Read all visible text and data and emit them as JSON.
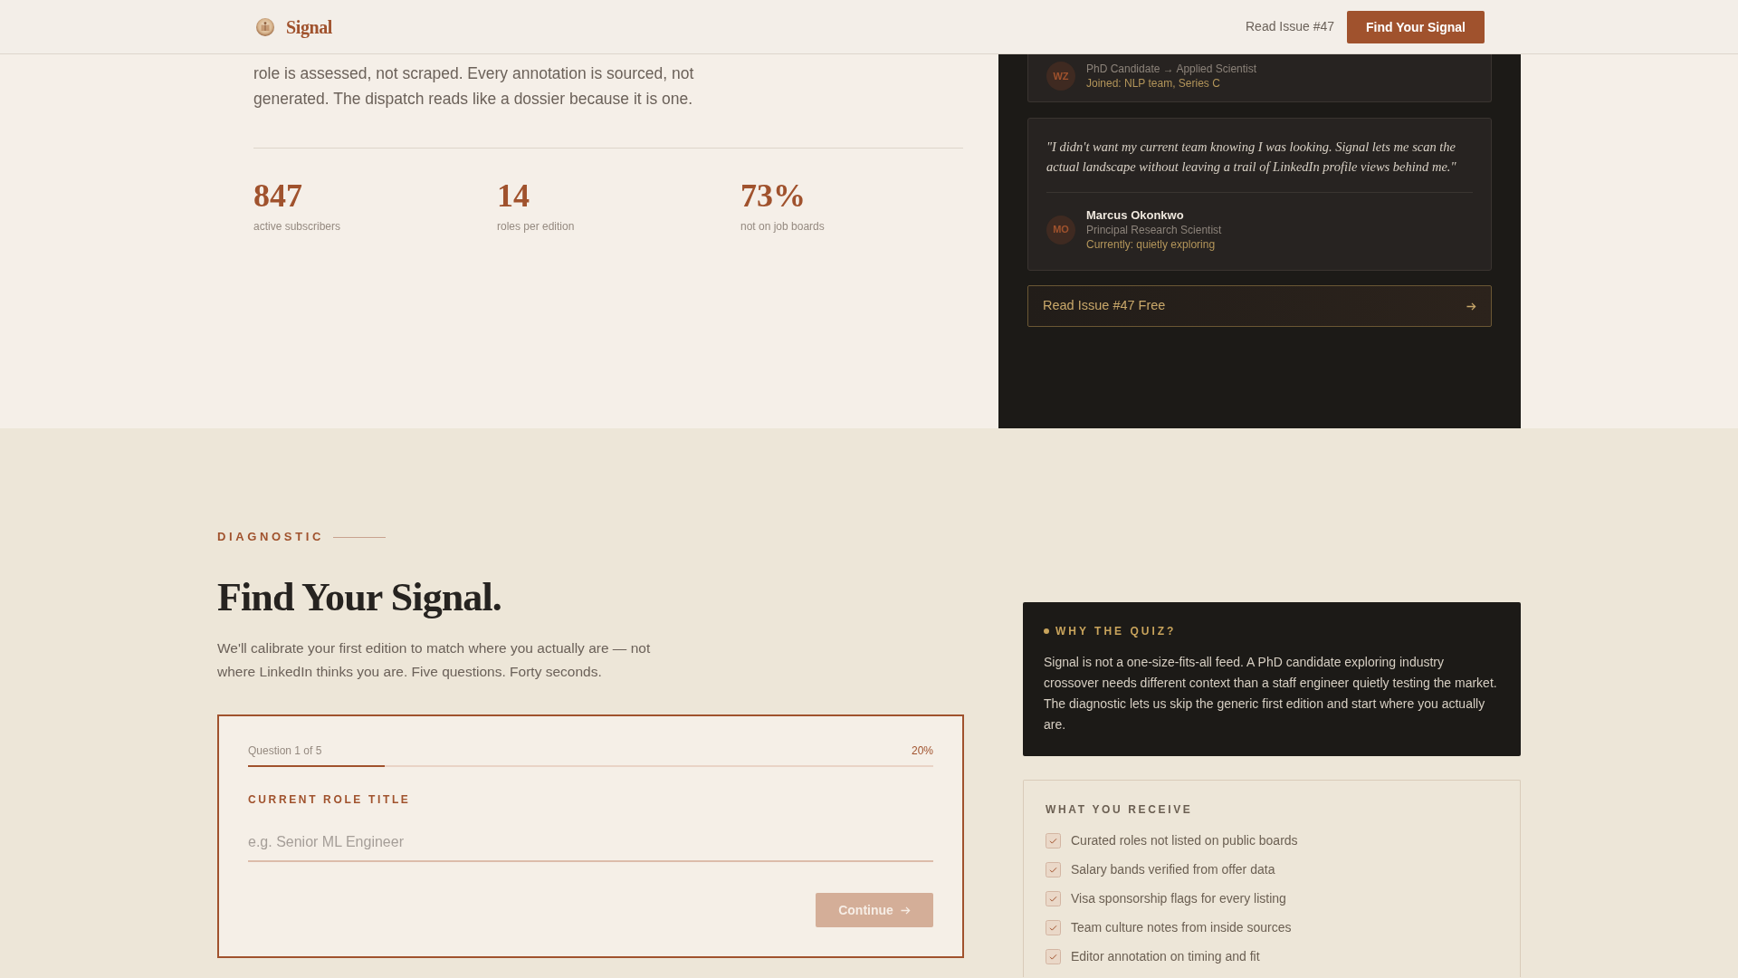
{
  "header": {
    "brand": "Signal",
    "link": "Read Issue #47",
    "button": "Find Your Signal"
  },
  "intro": {
    "text": "role is assessed, not scraped. Every annotation is sourced, not generated. The dispatch reads like a dossier because it is one."
  },
  "stats": [
    {
      "value": "847",
      "label": "active subscribers"
    },
    {
      "value": "14",
      "label": "roles per edition"
    },
    {
      "value": "73%",
      "label": "not on job boards"
    }
  ],
  "testimonials": [
    {
      "initials": "WZ",
      "role": "PhD Candidate → Applied Scientist",
      "outcome": "Joined: NLP team, Series C"
    },
    {
      "quote": "\"I didn't want my current team knowing I was looking. Signal lets me scan the actual landscape without leaving a trail of LinkedIn profile views behind me.\"",
      "initials": "MO",
      "name": "Marcus Okonkwo",
      "role": "Principal Research Scientist",
      "outcome": "Currently: quietly exploring"
    }
  ],
  "panel_link": "Read Issue #47 Free",
  "diagnostic": {
    "eyebrow": "DIAGNOSTIC",
    "title": "Find Your Signal.",
    "text": "We'll calibrate your first edition to match where you actually are — not where LinkedIn thinks you are. Five questions. Forty seconds."
  },
  "quiz": {
    "step": "Question 1 of 5",
    "percent": "20%",
    "level": 0.2,
    "field_label": "CURRENT ROLE TITLE",
    "placeholder": "e.g. Senior ML Engineer",
    "button": {
      "label": "Continue",
      "disabled": true
    }
  },
  "why": {
    "title": "WHY THE QUIZ?",
    "text": "Signal is not a one-size-fits-all feed. A PhD candidate exploring industry crossover needs different context than a staff engineer quietly testing the market. The diagnostic lets us skip the generic first edition and start where you actually are."
  },
  "receive": {
    "title": "WHAT YOU RECEIVE",
    "items": [
      {
        "label": "Curated roles not listed on public boards",
        "checked": true
      },
      {
        "label": "Salary bands verified from offer data",
        "checked": true
      },
      {
        "label": "Visa sponsorship flags for every listing",
        "checked": true
      },
      {
        "label": "Team culture notes from inside sources",
        "checked": true
      },
      {
        "label": "Editor annotation on timing and fit",
        "checked": true
      }
    ]
  }
}
